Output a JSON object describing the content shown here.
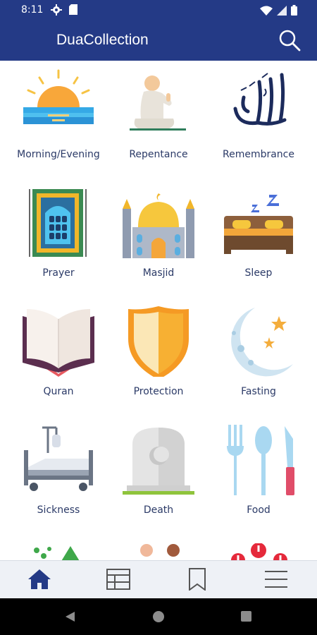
{
  "status_bar": {
    "time": "8:11",
    "icons": [
      "gear-icon",
      "sd-card-icon",
      "wifi-icon",
      "signal-icon",
      "battery-icon"
    ]
  },
  "app_bar": {
    "title": "DuaCollection",
    "search_icon": "search-icon"
  },
  "categories": [
    {
      "label": "Morning/Evening",
      "icon": "sunrise-icon"
    },
    {
      "label": "Repentance",
      "icon": "praying-person-icon"
    },
    {
      "label": "Remembrance",
      "icon": "allah-calligraphy-icon"
    },
    {
      "label": "Prayer",
      "icon": "prayer-rug-icon"
    },
    {
      "label": "Masjid",
      "icon": "mosque-icon"
    },
    {
      "label": "Sleep",
      "icon": "bed-icon"
    },
    {
      "label": "Quran",
      "icon": "open-book-icon"
    },
    {
      "label": "Protection",
      "icon": "shield-icon"
    },
    {
      "label": "Fasting",
      "icon": "crescent-moon-icon"
    },
    {
      "label": "Sickness",
      "icon": "hospital-bed-icon"
    },
    {
      "label": "Death",
      "icon": "gravestone-icon"
    },
    {
      "label": "Food",
      "icon": "cutlery-icon"
    }
  ],
  "bottom_nav": [
    {
      "icon": "home-icon",
      "active": true
    },
    {
      "icon": "table-icon",
      "active": false
    },
    {
      "icon": "bookmark-icon",
      "active": false
    },
    {
      "icon": "menu-icon",
      "active": false
    }
  ],
  "colors": {
    "primary": "#243a86",
    "label": "#2b3a67",
    "nav_background": "#eef1f6"
  }
}
